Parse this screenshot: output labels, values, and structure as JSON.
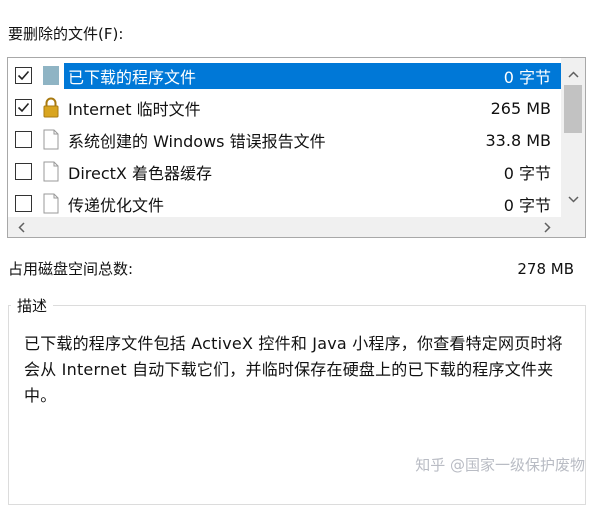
{
  "files_label": "要删除的文件(F):",
  "files": [
    {
      "name": "已下载的程序文件",
      "size": "0 字节",
      "checked": true,
      "icon": "folder-icon",
      "selected": true
    },
    {
      "name": "Internet 临时文件",
      "size": "265 MB",
      "checked": true,
      "icon": "lock-icon",
      "selected": false
    },
    {
      "name": "系统创建的 Windows 错误报告文件",
      "size": "33.8 MB",
      "checked": false,
      "icon": "file-icon",
      "selected": false
    },
    {
      "name": "DirectX 着色器缓存",
      "size": "0 字节",
      "checked": false,
      "icon": "file-icon",
      "selected": false
    },
    {
      "name": "传递优化文件",
      "size": "0 字节",
      "checked": false,
      "icon": "file-icon",
      "selected": false
    }
  ],
  "scroll": {
    "up": "⌃",
    "down": "⌄",
    "left": "‹",
    "right": "›"
  },
  "total_label": "占用磁盘空间总数:",
  "total_value": "278 MB",
  "description": {
    "title": "描述",
    "text": "已下载的程序文件包括 ActiveX 控件和 Java 小程序，你查看特定网页时将会从 Internet 自动下载它们，并临时保存在硬盘上的已下载的程序文件夹中。"
  },
  "watermark": "知乎 @国家一级保护废物",
  "colors": {
    "selection": "#0078d7",
    "folder_icon": "#8fb4c4",
    "lock_icon": "#d9a520"
  }
}
